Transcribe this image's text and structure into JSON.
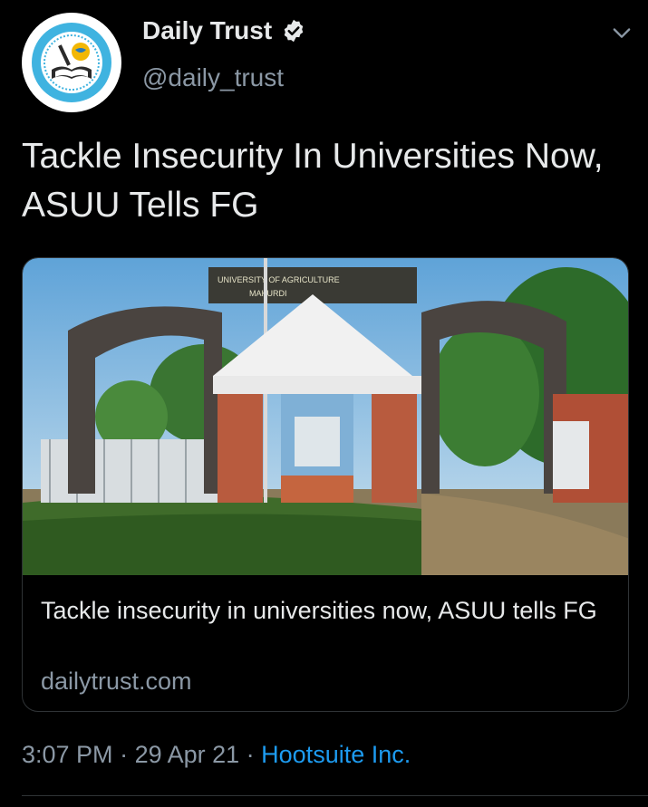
{
  "author": {
    "display_name": "Daily Trust",
    "handle": "@daily_trust",
    "verified_icon": "verified-badge-icon",
    "avatar_icon": "daily-trust-logo"
  },
  "menu_icon": "chevron-down-icon",
  "tweet": {
    "text": "Tackle Insecurity In Universities Now, ASUU Tells FG"
  },
  "link_card": {
    "image_icon": "university-gate-photo",
    "title": "Tackle insecurity in universities now, ASUU tells FG",
    "domain": "dailytrust.com"
  },
  "meta": {
    "time": "3:07 PM",
    "separator": " · ",
    "date": "29 Apr 21",
    "source": "Hootsuite Inc."
  },
  "colors": {
    "background": "#000000",
    "text": "#e7e9ea",
    "secondary": "#8b98a5",
    "link": "#1d9bf0",
    "border": "#2f3336"
  }
}
